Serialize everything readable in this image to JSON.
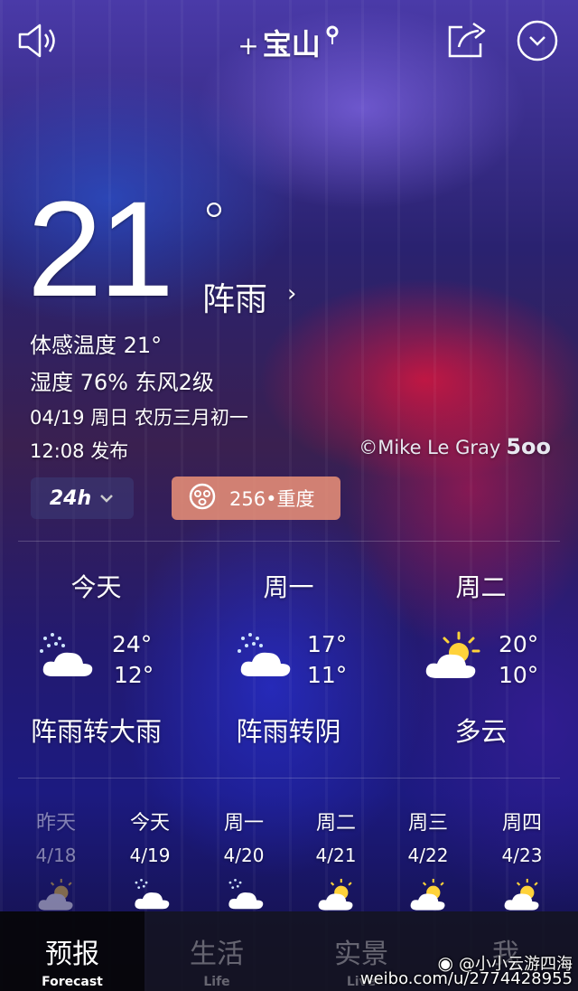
{
  "header": {
    "city": "宝山",
    "plus": "+"
  },
  "current": {
    "temperature": "21",
    "degree": "°",
    "condition": "阵雨",
    "feels_like": "体感温度 21°",
    "humidity_wind": "湿度 76% 东风2级",
    "date_line": "04/19 周日 农历三月初一",
    "published": "12:08 发布"
  },
  "credit": {
    "text": "©Mike Le Gray",
    "logo": "5oo"
  },
  "controls": {
    "hours_label": "24h",
    "aqi_label": "256•重度"
  },
  "daily": [
    {
      "name": "今天",
      "high": "24°",
      "low": "12°",
      "condition": "阵雨转大雨",
      "icon": "rain-cloud-icon"
    },
    {
      "name": "周一",
      "high": "17°",
      "low": "11°",
      "condition": "阵雨转阴",
      "icon": "rain-cloud-icon"
    },
    {
      "name": "周二",
      "high": "20°",
      "low": "10°",
      "condition": "多云",
      "icon": "partly-cloudy-icon"
    }
  ],
  "hourly": [
    {
      "name": "昨天",
      "date": "4/18",
      "icon": "partly-cloudy-icon"
    },
    {
      "name": "今天",
      "date": "4/19",
      "icon": "rain-cloud-icon"
    },
    {
      "name": "周一",
      "date": "4/20",
      "icon": "rain-cloud-icon"
    },
    {
      "name": "周二",
      "date": "4/21",
      "icon": "partly-cloudy-icon"
    },
    {
      "name": "周三",
      "date": "4/22",
      "icon": "partly-cloudy-icon"
    },
    {
      "name": "周四",
      "date": "4/23",
      "icon": "partly-cloudy-icon"
    }
  ],
  "tabs": [
    {
      "zh": "预报",
      "en": "Forecast"
    },
    {
      "zh": "生活",
      "en": "Life"
    },
    {
      "zh": "实景",
      "en": "Live"
    },
    {
      "zh": "我",
      "en": ""
    }
  ],
  "watermark": {
    "handle": "@小小云游四海",
    "url": "weibo.com/u/2774428955"
  }
}
